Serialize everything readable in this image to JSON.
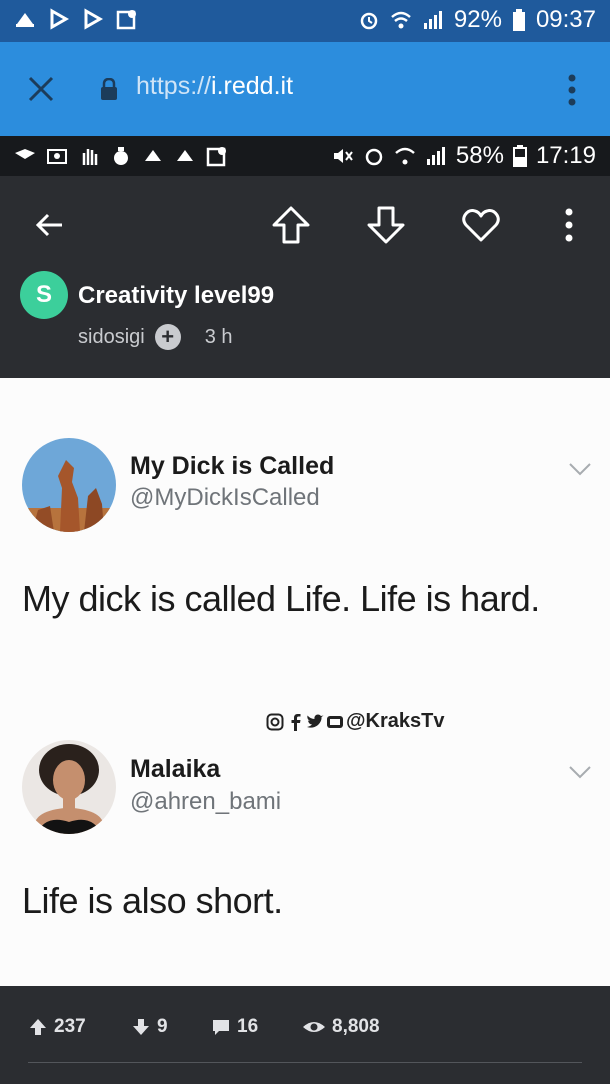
{
  "outer_status": {
    "battery": "92%",
    "time": "09:37",
    "left_icons": [
      "notification-icon",
      "play-store-icon",
      "play-store-icon",
      "maps-icon"
    ],
    "right_icons": [
      "alarm-icon",
      "wifi-icon",
      "signal-icon",
      "battery-icon"
    ]
  },
  "browser": {
    "url_protocol": "https://",
    "url_host": "i.redd.it"
  },
  "inner_status": {
    "battery": "58%",
    "time": "17:19",
    "left_icons": [
      "dropbox-icon",
      "photo-icon",
      "hand-icon",
      "money-bag-icon",
      "notification-icon",
      "notification-icon",
      "maps-icon"
    ],
    "right_icons": [
      "mute-icon",
      "alarm-icon",
      "wifi-icon",
      "signal-icon",
      "battery-icon"
    ]
  },
  "post": {
    "subreddit_initial": "S",
    "subreddit": "Creativity level99",
    "author": "sidosigi",
    "plus": "+",
    "time_ago": "3 h"
  },
  "tweets": [
    {
      "name": "My Dick is Called",
      "handle": "@MyDickIsCalled",
      "text": "My dick is called Life. Life is hard."
    },
    {
      "name": "Malaika",
      "handle": "@ahren_bami",
      "text": "Life is also short."
    }
  ],
  "watermark": "@KraksTv",
  "stats": {
    "upvotes": "237",
    "downvotes": "9",
    "comments": "16",
    "views": "8,808"
  },
  "colors": {
    "outer_status_bg": "#1f5a9c",
    "url_bar_bg": "#2c8ddd",
    "app_bg": "#2b2d31",
    "subreddit_avatar": "#3ccf9b"
  }
}
